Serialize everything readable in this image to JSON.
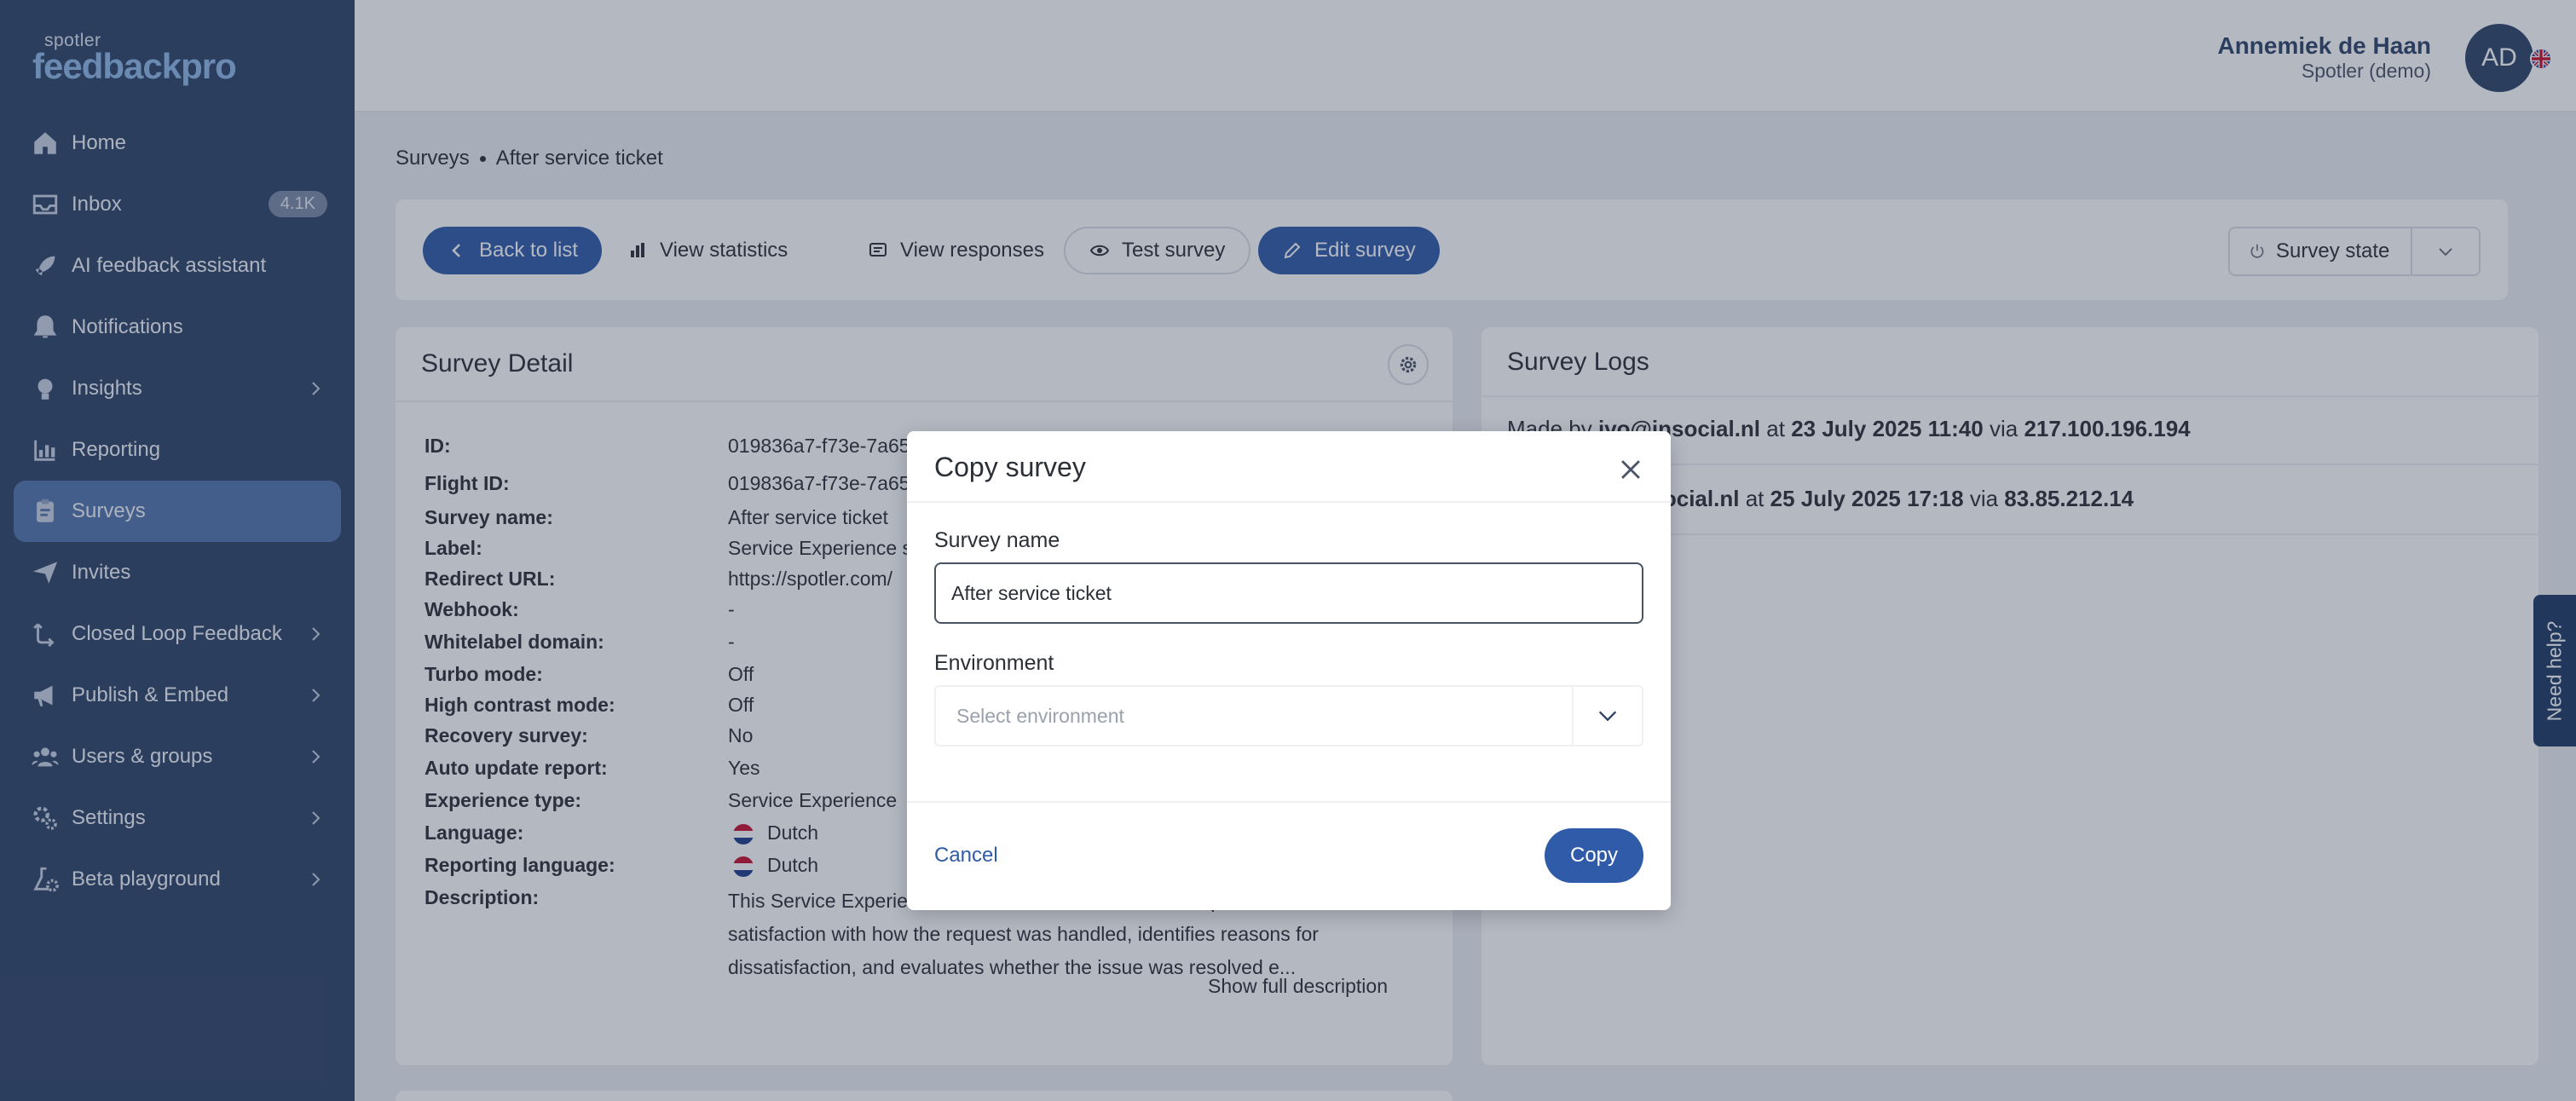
{
  "brand": {
    "small": "spotler",
    "big": "feedbackpro"
  },
  "sidebar": {
    "items": [
      {
        "label": "Home",
        "icon": "home-icon"
      },
      {
        "label": "Inbox",
        "icon": "inbox-icon",
        "badge": "4.1K"
      },
      {
        "label": "AI feedback assistant",
        "icon": "rocket-icon"
      },
      {
        "label": "Notifications",
        "icon": "bell-icon"
      },
      {
        "label": "Insights",
        "icon": "lightbulb-icon"
      },
      {
        "label": "Reporting",
        "icon": "bar-chart-icon"
      },
      {
        "label": "Surveys",
        "icon": "clipboard-icon"
      },
      {
        "label": "Invites",
        "icon": "paper-plane-icon"
      },
      {
        "label": "Closed Loop Feedback",
        "icon": "loop-icon"
      },
      {
        "label": "Publish & Embed",
        "icon": "megaphone-icon"
      },
      {
        "label": "Users & groups",
        "icon": "users-icon"
      },
      {
        "label": "Settings",
        "icon": "gears-icon"
      },
      {
        "label": "Beta playground",
        "icon": "flask-icon"
      }
    ]
  },
  "user": {
    "name": "Annemiek de Haan",
    "org": "Spotler (demo)",
    "initials": "AD"
  },
  "breadcrumb": {
    "root": "Surveys",
    "current": "After service ticket"
  },
  "toolbar": {
    "back": "Back to list",
    "statistics": "View statistics",
    "responses": "View responses",
    "test": "Test survey",
    "edit": "Edit survey",
    "state": "Survey state"
  },
  "detail": {
    "title": "Survey Detail",
    "fields": [
      {
        "label": "ID:",
        "value": "019836a7-f73e-7a65"
      },
      {
        "label": "Flight ID:",
        "value": "019836a7-f73e-7a65"
      },
      {
        "label": "Survey name:",
        "value": "After service ticket"
      },
      {
        "label": "Label:",
        "value": "Service Experience s"
      },
      {
        "label": "Redirect URL:",
        "value": "https://spotler.com/"
      },
      {
        "label": "Webhook:",
        "value": "-"
      },
      {
        "label": "Whitelabel domain:",
        "value": "-"
      },
      {
        "label": "Turbo mode:",
        "value": "Off"
      },
      {
        "label": "High contrast mode:",
        "value": "Off"
      },
      {
        "label": "Recovery survey:",
        "value": "No"
      },
      {
        "label": "Auto update report:",
        "value": "Yes"
      },
      {
        "label": "Experience type:",
        "value": "Service Experience"
      },
      {
        "label": "Language:",
        "value": "Dutch"
      },
      {
        "label": "Reporting language:",
        "value": "Dutch"
      },
      {
        "label": "Description:",
        "value": ""
      }
    ],
    "description": "This Service Experie after the resolution of a service request. It assesses satisfaction with how the request was handled, identifies reasons for dissatisfaction, and evaluates whether the issue was resolved e...",
    "show_full": "Show full description"
  },
  "logs": {
    "title": "Survey Logs",
    "entries": [
      {
        "prefix": "Made by",
        "user": "ivo@insocial.nl",
        "at": "at",
        "date": "23 July 2025 11:40",
        "via": "via",
        "ip": "217.100.196.194"
      },
      {
        "prefix": "",
        "user": "annemiek@insocial.nl",
        "at": "at",
        "date": "25 July 2025 17:18",
        "via": "via",
        "ip": "83.85.212.14"
      }
    ]
  },
  "help_tab": "Need help?",
  "modal": {
    "title": "Copy survey",
    "name_label": "Survey name",
    "name_value": "After service ticket",
    "env_label": "Environment",
    "env_placeholder": "Select environment",
    "cancel": "Cancel",
    "copy": "Copy"
  },
  "colors": {
    "sidebar": "#2f4468",
    "active": "#5476ad",
    "primary": "#2f5ba8",
    "overlay": "rgba(40,52,78,0.35)"
  }
}
